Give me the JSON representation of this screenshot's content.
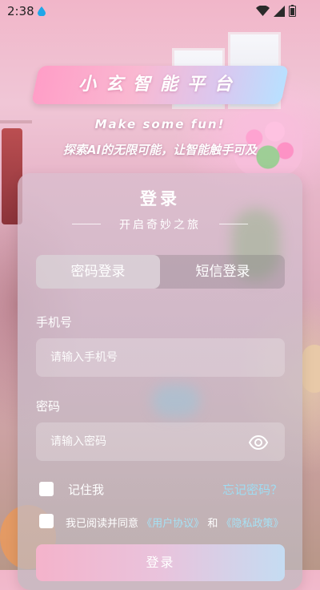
{
  "status_bar": {
    "time": "2:38"
  },
  "header": {
    "title": "小玄智能平台",
    "tagline_en": "Make some fun!",
    "tagline_cn": "探索AI的无限可能，让智能触手可及"
  },
  "login_card": {
    "title": "登录",
    "subtitle": "开启奇妙之旅",
    "tabs": [
      {
        "label": "密码登录",
        "active": true
      },
      {
        "label": "短信登录",
        "active": false
      }
    ],
    "phone": {
      "label": "手机号",
      "placeholder": "请输入手机号",
      "value": ""
    },
    "password": {
      "label": "密码",
      "placeholder": "请输入密码",
      "value": ""
    },
    "remember_me": {
      "label": "记住我",
      "checked": false
    },
    "forgot_password": "忘记密码？",
    "agreement": {
      "checked": false,
      "prefix": "我已阅读并同意",
      "user_agreement": "《用户协议》",
      "conjunction": "和",
      "privacy_policy": "《隐私政策》"
    },
    "login_button": "登录"
  },
  "icons": {
    "status_drop": "water-drop-icon",
    "wifi": "wifi-icon",
    "signal": "cell-signal-icon",
    "battery": "battery-icon",
    "password_visibility": "eye-icon"
  },
  "colors": {
    "link": "#a6e1f4",
    "banner_gradient_start": "#ff9ec7",
    "banner_gradient_end": "#b9e0ff"
  }
}
